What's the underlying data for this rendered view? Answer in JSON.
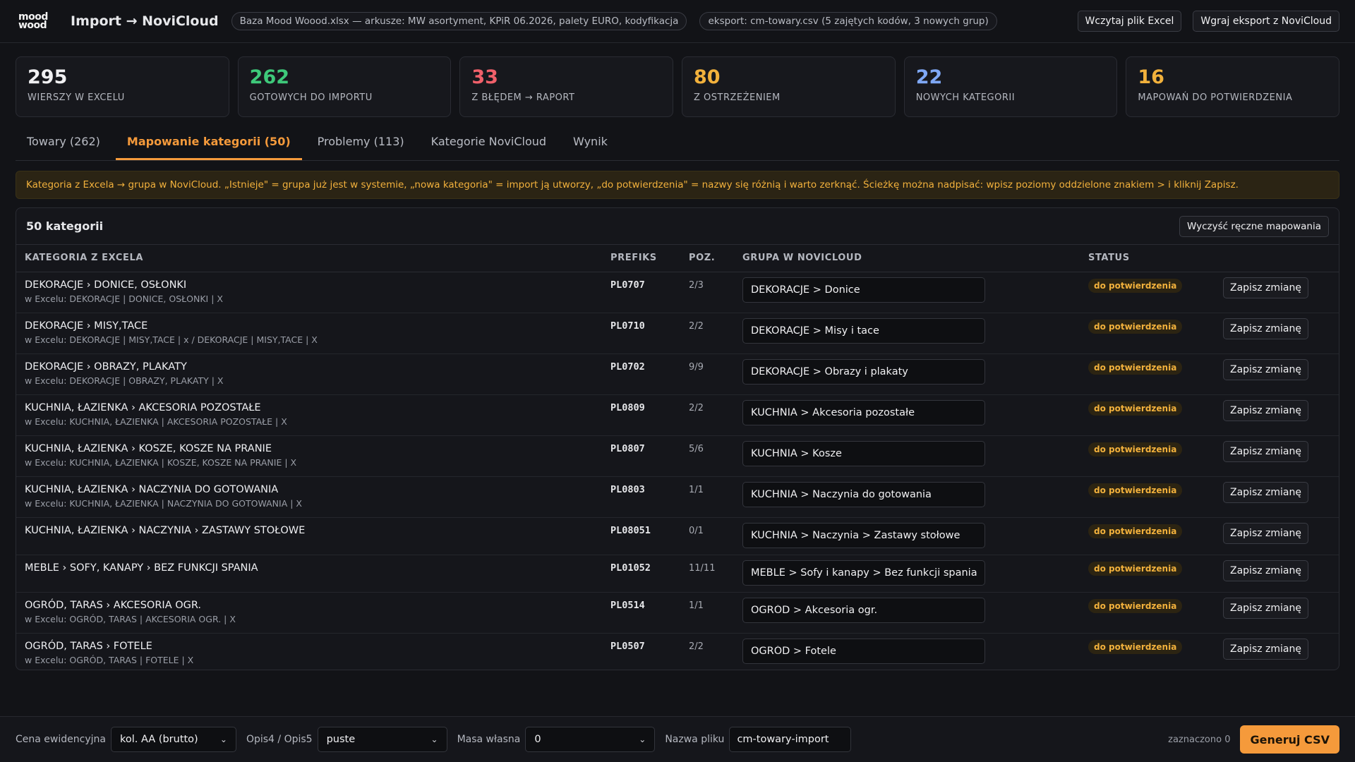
{
  "header": {
    "logo_line1": "mood",
    "logo_line2": "wood",
    "title": "Import → NoviCloud",
    "source_pill": "Baza Mood Woood.xlsx — arkusze: MW asortyment, KPiR 06.2026, palety EURO, kodyfikacja",
    "export_pill": "eksport: cm-towary.csv (5 zajętych kodów, 3 nowych grup)",
    "load_excel_label": "Wczytaj plik Excel",
    "load_export_label": "Wgraj eksport z NoviCloud"
  },
  "stats": [
    {
      "value": "295",
      "label": "WIERSZY W EXCELU",
      "color": "#f0f0f2"
    },
    {
      "value": "262",
      "label": "GOTOWYCH DO IMPORTU",
      "color": "#3ec97a"
    },
    {
      "value": "33",
      "label": "Z BŁĘDEM → RAPORT",
      "color": "#f0606a"
    },
    {
      "value": "80",
      "label": "Z OSTRZEŻENIEM",
      "color": "#f2b13c"
    },
    {
      "value": "22",
      "label": "NOWYCH KATEGORII",
      "color": "#7fa8f5"
    },
    {
      "value": "16",
      "label": "MAPOWAŃ DO POTWIERDZENIA",
      "color": "#f2b13c"
    }
  ],
  "tabs": [
    {
      "label": "Towary (262)",
      "active": false
    },
    {
      "label": "Mapowanie kategorii (50)",
      "active": true
    },
    {
      "label": "Problemy (113)",
      "active": false
    },
    {
      "label": "Kategorie NoviCloud",
      "active": false
    },
    {
      "label": "Wynik",
      "active": false
    }
  ],
  "info_text": "Kategoria z Excela → grupa w NoviCloud. „Istnieje\" = grupa już jest w systemie, „nowa kategoria\" = import ją utworzy, „do potwierdzenia\" = nazwy się różnią i warto zerknąć. Ścieżkę można nadpisać: wpisz poziomy oddzielone znakiem > i kliknij Zapisz.",
  "panel": {
    "title": "50 kategorii",
    "clear_label": "Wyczyść ręczne mapowania",
    "columns": {
      "category": "KATEGORIA Z EXCELA",
      "prefix": "PREFIKS",
      "poz": "POZ.",
      "group": "GRUPA W NOVICLOUD",
      "status": "STATUS"
    },
    "rows": [
      {
        "category": "DEKORACJE › DONICE, OSŁONKI",
        "excel": "w Excelu: DEKORACJE | DONICE, OSŁONKI | X",
        "prefix": "PL0707",
        "poz": "2/3",
        "group": "DEKORACJE > Donice",
        "status": "do potwierdzenia",
        "save": "Zapisz zmianę"
      },
      {
        "category": "DEKORACJE › MISY,TACE",
        "excel": "w Excelu: DEKORACJE | MISY,TACE | x / DEKORACJE | MISY,TACE | X",
        "prefix": "PL0710",
        "poz": "2/2",
        "group": "DEKORACJE > Misy i tace",
        "status": "do potwierdzenia",
        "save": "Zapisz zmianę"
      },
      {
        "category": "DEKORACJE › OBRAZY, PLAKATY",
        "excel": "w Excelu: DEKORACJE | OBRAZY, PLAKATY | X",
        "prefix": "PL0702",
        "poz": "9/9",
        "group": "DEKORACJE > Obrazy i plakaty",
        "status": "do potwierdzenia",
        "save": "Zapisz zmianę"
      },
      {
        "category": "KUCHNIA, ŁAZIENKA › AKCESORIA POZOSTAŁE",
        "excel": "w Excelu: KUCHNIA, ŁAZIENKA | AKCESORIA POZOSTAŁE | X",
        "prefix": "PL0809",
        "poz": "2/2",
        "group": "KUCHNIA > Akcesoria pozostałe",
        "status": "do potwierdzenia",
        "save": "Zapisz zmianę"
      },
      {
        "category": "KUCHNIA, ŁAZIENKA › KOSZE, KOSZE NA PRANIE",
        "excel": "w Excelu: KUCHNIA, ŁAZIENKA | KOSZE, KOSZE NA PRANIE | X",
        "prefix": "PL0807",
        "poz": "5/6",
        "group": "KUCHNIA > Kosze",
        "status": "do potwierdzenia",
        "save": "Zapisz zmianę"
      },
      {
        "category": "KUCHNIA, ŁAZIENKA › NACZYNIA DO GOTOWANIA",
        "excel": "w Excelu: KUCHNIA, ŁAZIENKA | NACZYNIA DO GOTOWANIA | X",
        "prefix": "PL0803",
        "poz": "1/1",
        "group": "KUCHNIA > Naczynia do gotowania",
        "status": "do potwierdzenia",
        "save": "Zapisz zmianę"
      },
      {
        "category": "KUCHNIA, ŁAZIENKA › NACZYNIA › ZASTAWY STOŁOWE",
        "excel": "",
        "prefix": "PL08051",
        "poz": "0/1",
        "group": "KUCHNIA > Naczynia > Zastawy stołowe",
        "status": "do potwierdzenia",
        "save": "Zapisz zmianę"
      },
      {
        "category": "MEBLE › SOFY, KANAPY › BEZ FUNKCJI SPANIA",
        "excel": "",
        "prefix": "PL01052",
        "poz": "11/11",
        "group": "MEBLE > Sofy i kanapy > Bez funkcji spania",
        "status": "do potwierdzenia",
        "save": "Zapisz zmianę"
      },
      {
        "category": "OGRÓD, TARAS › AKCESORIA OGR.",
        "excel": "w Excelu: OGRÓD, TARAS | AKCESORIA OGR. | X",
        "prefix": "PL0514",
        "poz": "1/1",
        "group": "OGRÓD > Akcesoria ogr.",
        "status": "do potwierdzenia",
        "save": "Zapisz zmianę"
      },
      {
        "category": "OGRÓD, TARAS › FOTELE",
        "excel": "w Excelu: OGRÓD, TARAS | FOTELE | X",
        "prefix": "PL0507",
        "poz": "2/2",
        "group": "OGRÓD > Fotele",
        "status": "do potwierdzenia",
        "save": "Zapisz zmianę"
      }
    ]
  },
  "footer": {
    "price_label": "Cena ewidencyjna",
    "price_value": "kol. AA (brutto)",
    "opis_label": "Opis4 / Opis5",
    "opis_value": "puste",
    "mass_label": "Masa własna",
    "mass_value": "0",
    "filename_label": "Nazwa pliku",
    "filename_value": "cm-towary-import",
    "selected_count": "zaznaczono 0",
    "generate_label": "Generuj CSV"
  },
  "icons": {
    "select_chevron": "chevron-down-icon"
  }
}
